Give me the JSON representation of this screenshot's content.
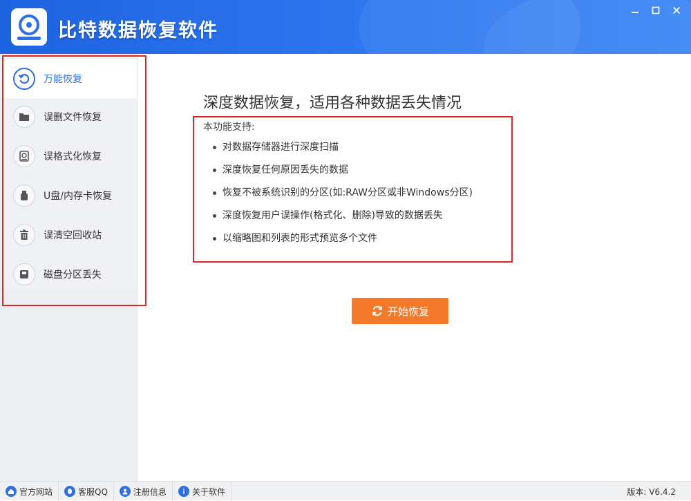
{
  "app": {
    "title": "比特数据恢复软件",
    "accent_color": "#2e6fe6",
    "titlebar_color": "#2a70ec",
    "window_controls": [
      "minimize-icon",
      "maximize-icon",
      "close-icon"
    ]
  },
  "sidebar": {
    "items": [
      {
        "label": "万能恢复",
        "icon": "restore-icon",
        "active": true
      },
      {
        "label": "误删文件恢复",
        "icon": "folder-icon",
        "active": false
      },
      {
        "label": "误格式化恢复",
        "icon": "disk-format-icon",
        "active": false
      },
      {
        "label": "U盘/内存卡恢复",
        "icon": "usb-drive-icon",
        "active": false
      },
      {
        "label": "误清空回收站",
        "icon": "trash-icon",
        "active": false
      },
      {
        "label": "磁盘分区丢失",
        "icon": "partition-icon",
        "active": false
      }
    ]
  },
  "main": {
    "title": "深度数据恢复，适用各种数据丢失情况",
    "support_label": "本功能支持:",
    "features": [
      "对数据存储器进行深度扫描",
      "深度恢复任何原因丢失的数据",
      "恢复不被系统识别的分区(如:RAW分区或非Windows分区)",
      "深度恢复用户误操作(格式化、删除)导致的数据丢失",
      "以缩略图和列表的形式预览多个文件"
    ],
    "start_button": {
      "label": "开始恢复",
      "icon": "refresh-icon",
      "color": "#f5792a"
    }
  },
  "footer": {
    "links": [
      {
        "label": "官方网站",
        "icon": "home-icon"
      },
      {
        "label": "客服QQ",
        "icon": "qq-icon"
      },
      {
        "label": "注册信息",
        "icon": "user-icon"
      },
      {
        "label": "关于软件",
        "icon": "info-icon"
      }
    ],
    "version": "版本: V6.4.2"
  }
}
